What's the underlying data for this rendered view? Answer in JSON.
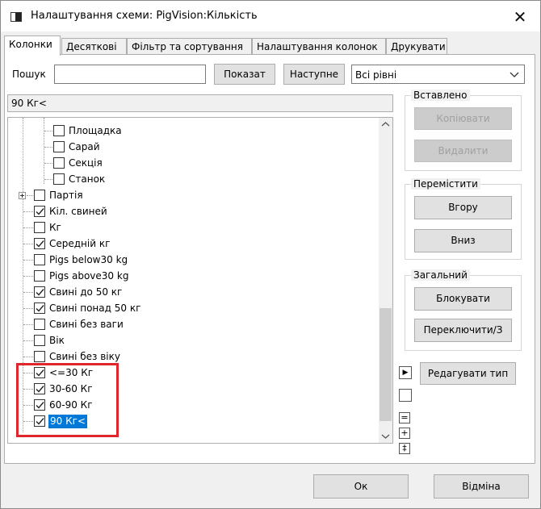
{
  "window": {
    "title": "Налаштування схеми: PigVision:Кількість",
    "close_glyph": "✕"
  },
  "tabs": [
    {
      "label": "Колонки"
    },
    {
      "label": "Десяткові"
    },
    {
      "label": "Фільтр та сортування"
    },
    {
      "label": "Налаштування колонок"
    },
    {
      "label": "Друкувати"
    }
  ],
  "search": {
    "label": "Пошук",
    "value": "",
    "show_button": "Показат",
    "next_button": "Наступне",
    "level_select": "Всі рівні"
  },
  "path": "90 Кг<",
  "tree": {
    "items": [
      {
        "label": "Площадка",
        "checked": false
      },
      {
        "label": "Сарай",
        "checked": false
      },
      {
        "label": "Секція",
        "checked": false
      },
      {
        "label": "Станок",
        "checked": false
      },
      {
        "label": "Партія",
        "checked": false
      },
      {
        "label": "Кіл. свиней",
        "checked": true
      },
      {
        "label": "Кг",
        "checked": false
      },
      {
        "label": "Середній кг",
        "checked": true
      },
      {
        "label": "Pigs below30 kg",
        "checked": false
      },
      {
        "label": "Pigs above30 kg",
        "checked": false
      },
      {
        "label": "Свині до 50 кг",
        "checked": true
      },
      {
        "label": "Свині понад 50 кг",
        "checked": true
      },
      {
        "label": "Свині без ваги",
        "checked": false
      },
      {
        "label": "Вік",
        "checked": false
      },
      {
        "label": "Свині без віку",
        "checked": false
      },
      {
        "label": "<=30 Кг",
        "checked": true
      },
      {
        "label": "30-60 Кг",
        "checked": true
      },
      {
        "label": "60-90 Кг",
        "checked": true
      },
      {
        "label": "90 Кг<",
        "checked": true
      }
    ]
  },
  "groups": {
    "inserted": {
      "title": "Вставлено",
      "copy": "Копіювати",
      "delete": "Видалити"
    },
    "move": {
      "title": "Перемістити",
      "up": "Вгору",
      "down": "Вниз"
    },
    "general": {
      "title": "Загальний",
      "lock": "Блокувати",
      "toggle": "Переключити/З"
    }
  },
  "edit_type_button": "Редагувати тип",
  "side_controls": {
    "arrow": "▶",
    "equal": "=",
    "plus": "+",
    "updown": "‡"
  },
  "footer": {
    "ok": "Ок",
    "cancel": "Відміна"
  },
  "colors": {
    "selection": "#0078d7",
    "highlight_border": "#e0262d"
  }
}
